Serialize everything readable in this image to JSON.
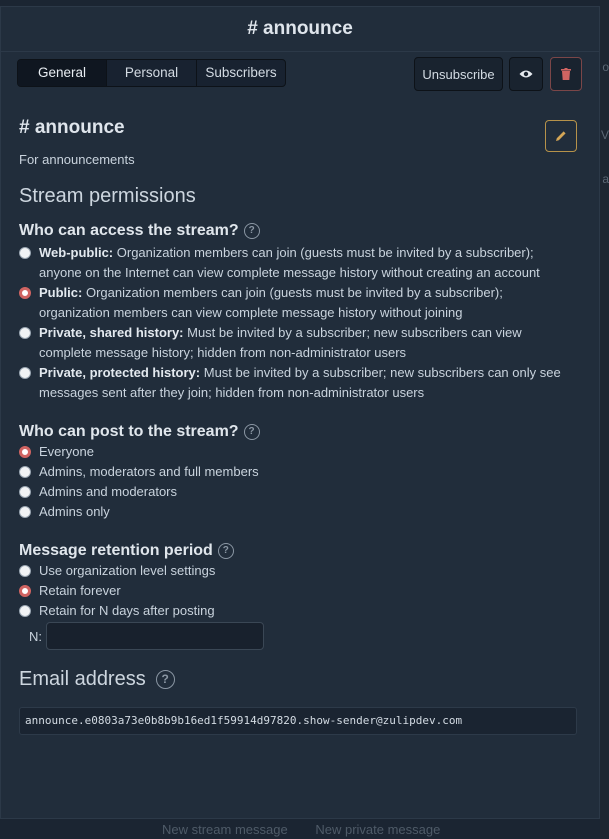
{
  "header": {
    "title": "# announce"
  },
  "tabs": [
    {
      "label": "General",
      "active": true
    },
    {
      "label": "Personal",
      "active": false
    },
    {
      "label": "Subscribers",
      "active": false
    }
  ],
  "actions": {
    "unsubscribe_label": "Unsubscribe",
    "view_icon": "eye-icon",
    "delete_icon": "trash-icon"
  },
  "stream": {
    "name": "# announce",
    "description": "For announcements",
    "edit_icon": "pencil-icon"
  },
  "permissions": {
    "section_title": "Stream permissions",
    "access": {
      "title": "Who can access the stream?",
      "options": [
        {
          "label": "Web-public:",
          "desc": "Organization members can join (guests must be invited by a subscriber); anyone on the Internet can view complete message history without creating an account",
          "checked": false
        },
        {
          "label": "Public:",
          "desc": "Organization members can join (guests must be invited by a subscriber); organization members can view complete message history without joining",
          "checked": true
        },
        {
          "label": "Private, shared history:",
          "desc": "Must be invited by a subscriber; new subscribers can view complete message history; hidden from non-administrator users",
          "checked": false
        },
        {
          "label": "Private, protected history:",
          "desc": "Must be invited by a subscriber; new subscribers can only see messages sent after they join; hidden from non-administrator users",
          "checked": false
        }
      ]
    },
    "post": {
      "title": "Who can post to the stream?",
      "options": [
        {
          "label": "Everyone",
          "checked": true
        },
        {
          "label": "Admins, moderators and full members",
          "checked": false
        },
        {
          "label": "Admins and moderators",
          "checked": false
        },
        {
          "label": "Admins only",
          "checked": false
        }
      ]
    },
    "retention": {
      "title": "Message retention period",
      "options": [
        {
          "label": "Use organization level settings",
          "checked": false
        },
        {
          "label": "Retain forever",
          "checked": true
        },
        {
          "label": "Retain for N days after posting",
          "checked": false
        }
      ],
      "n_label": "N:",
      "n_value": ""
    }
  },
  "email": {
    "title": "Email address",
    "address": "announce.e0803a73e0b8b9b16ed1f59914d97820.show-sender@zulipdev.com"
  },
  "backdrop": {
    "links": [
      "New stream message",
      "New private message"
    ]
  },
  "colors": {
    "accent": "#d06462",
    "edit_border": "#b6924a",
    "delete": "#d06462"
  }
}
